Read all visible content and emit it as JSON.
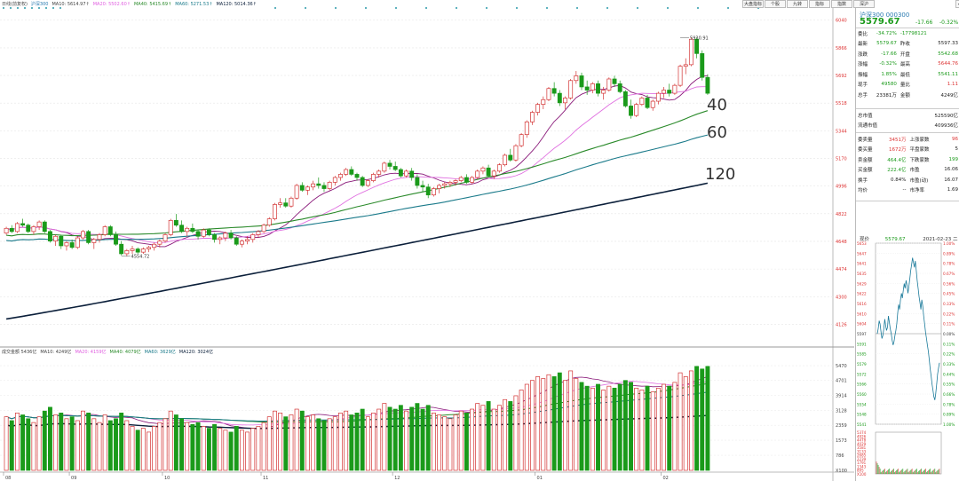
{
  "main_legend": {
    "items": [
      {
        "text": "日线(前复权)",
        "color": "#444444"
      },
      {
        "text": "沪深300",
        "color": "#2a7ab0"
      },
      {
        "text": "MA10: 5614.97↑",
        "color": "#444444"
      },
      {
        "text": "MA20: 5502.60↑",
        "color": "#e060e0"
      },
      {
        "text": "MA40: 5415.69↑",
        "color": "#2a8a2a"
      },
      {
        "text": "MA60: 5271.53↑",
        "color": "#1a7a8a"
      },
      {
        "text": "MA120: 5014.36↑",
        "color": "#0b1f3a"
      }
    ]
  },
  "volume_legend": {
    "items": [
      {
        "text": "成交金额 5436亿",
        "color": "#444444"
      },
      {
        "text": "MA10: 4249亿",
        "color": "#444444"
      },
      {
        "text": "MA20: 4159亿",
        "color": "#e060e0"
      },
      {
        "text": "MA40: 4079亿",
        "color": "#2a8a2a"
      },
      {
        "text": "MA60: 3629亿",
        "color": "#1a7a8a"
      },
      {
        "text": "MA120: 3024亿",
        "color": "#0b1f3a"
      }
    ]
  },
  "toolbar": {
    "buttons": [
      "大盘指标",
      "个股",
      "九转",
      "指标",
      "指数",
      "深沪"
    ]
  },
  "annotations": {
    "high_label": "5930.91",
    "low_label": "4554.72",
    "ma40_label": "40",
    "ma60_label": "60",
    "ma120_label": "120"
  },
  "colors": {
    "up": "#d33333",
    "down": "#1a9a1a",
    "ma10": "#8a1a7a",
    "ma20": "#e070e0",
    "ma40": "#2a8a2a",
    "ma60": "#1a7a8a",
    "ma120": "#0b1f3a"
  },
  "chart_data": {
    "type": "candlestick",
    "price_axis_ticks": [
      "6040",
      "5866",
      "5692",
      "5518",
      "5344",
      "5170",
      "4996",
      "4822",
      "4648",
      "4474",
      "4300",
      "4126"
    ],
    "price_ylim": [
      4000,
      6100
    ],
    "volume_axis_ticks": [
      "5470",
      "4701",
      "3914",
      "3128",
      "2359",
      "1573",
      "786",
      "X100"
    ],
    "volume_ylim": [
      0,
      5800
    ],
    "x_ticks": [
      {
        "label": "08",
        "index": 0
      },
      {
        "label": "09",
        "index": 12
      },
      {
        "label": "10",
        "index": 29
      },
      {
        "label": "11",
        "index": 47
      },
      {
        "label": "12",
        "index": 71
      },
      {
        "label": "01",
        "index": 97
      },
      {
        "label": "02",
        "index": 120
      }
    ],
    "ohlc": [
      [
        4700,
        4740,
        4690,
        4730,
        2800
      ],
      [
        4730,
        4750,
        4700,
        4710,
        2600
      ],
      [
        4710,
        4770,
        4700,
        4760,
        3000
      ],
      [
        4760,
        4790,
        4740,
        4750,
        2900
      ],
      [
        4750,
        4760,
        4700,
        4710,
        2700
      ],
      [
        4710,
        4750,
        4690,
        4740,
        2500
      ],
      [
        4740,
        4780,
        4720,
        4770,
        2800
      ],
      [
        4770,
        4780,
        4700,
        4710,
        3100
      ],
      [
        4710,
        4720,
        4640,
        4650,
        3300
      ],
      [
        4650,
        4690,
        4620,
        4680,
        2900
      ],
      [
        4680,
        4690,
        4600,
        4620,
        3000
      ],
      [
        4620,
        4650,
        4590,
        4640,
        2700
      ],
      [
        4640,
        4660,
        4600,
        4610,
        2800
      ],
      [
        4610,
        4680,
        4600,
        4670,
        2600
      ],
      [
        4670,
        4720,
        4660,
        4710,
        3100
      ],
      [
        4710,
        4720,
        4630,
        4640,
        3000
      ],
      [
        4640,
        4670,
        4600,
        4660,
        2700
      ],
      [
        4660,
        4700,
        4640,
        4690,
        2500
      ],
      [
        4690,
        4750,
        4680,
        4740,
        2900
      ],
      [
        4740,
        4750,
        4680,
        4690,
        2600
      ],
      [
        4690,
        4710,
        4620,
        4630,
        2700
      ],
      [
        4630,
        4650,
        4560,
        4570,
        3000
      ],
      [
        4570,
        4600,
        4555,
        4590,
        2600
      ],
      [
        4590,
        4620,
        4570,
        4600,
        2300
      ],
      [
        4600,
        4610,
        4570,
        4580,
        2100
      ],
      [
        4580,
        4610,
        4570,
        4600,
        2200
      ],
      [
        4600,
        4620,
        4580,
        4610,
        2000
      ],
      [
        4610,
        4640,
        4590,
        4630,
        2300
      ],
      [
        4630,
        4660,
        4610,
        4650,
        2500
      ],
      [
        4650,
        4700,
        4640,
        4690,
        2700
      ],
      [
        4690,
        4790,
        4680,
        4780,
        3100
      ],
      [
        4780,
        4820,
        4740,
        4750,
        2900
      ],
      [
        4750,
        4780,
        4700,
        4710,
        2700
      ],
      [
        4710,
        4740,
        4680,
        4730,
        2500
      ],
      [
        4730,
        4760,
        4700,
        4710,
        2400
      ],
      [
        4710,
        4720,
        4660,
        4680,
        2500
      ],
      [
        4680,
        4730,
        4670,
        4720,
        2300
      ],
      [
        4720,
        4730,
        4680,
        4690,
        2200
      ],
      [
        4690,
        4700,
        4640,
        4660,
        2400
      ],
      [
        4660,
        4680,
        4630,
        4670,
        2200
      ],
      [
        4670,
        4710,
        4650,
        4700,
        2100
      ],
      [
        4700,
        4720,
        4660,
        4670,
        2000
      ],
      [
        4670,
        4680,
        4620,
        4630,
        2300
      ],
      [
        4630,
        4660,
        4610,
        4650,
        2100
      ],
      [
        4650,
        4680,
        4630,
        4660,
        2000
      ],
      [
        4660,
        4700,
        4640,
        4690,
        2200
      ],
      [
        4690,
        4720,
        4670,
        4710,
        2300
      ],
      [
        4710,
        4760,
        4700,
        4750,
        2500
      ],
      [
        4750,
        4800,
        4740,
        4790,
        2800
      ],
      [
        4790,
        4890,
        4780,
        4880,
        3100
      ],
      [
        4880,
        4920,
        4860,
        4890,
        3000
      ],
      [
        4890,
        4920,
        4860,
        4870,
        2800
      ],
      [
        4870,
        4930,
        4860,
        4920,
        2900
      ],
      [
        4920,
        5010,
        4910,
        5000,
        3200
      ],
      [
        5000,
        5020,
        4960,
        4970,
        3100
      ],
      [
        4970,
        5000,
        4940,
        4990,
        2800
      ],
      [
        4990,
        5030,
        4970,
        5010,
        2900
      ],
      [
        5010,
        5050,
        4980,
        5000,
        2700
      ],
      [
        5000,
        5020,
        4960,
        4980,
        2600
      ],
      [
        4980,
        5030,
        4970,
        5020,
        2700
      ],
      [
        5020,
        5060,
        5000,
        5050,
        2800
      ],
      [
        5050,
        5080,
        5030,
        5070,
        3000
      ],
      [
        5070,
        5110,
        5060,
        5100,
        3100
      ],
      [
        5100,
        5120,
        5060,
        5070,
        2900
      ],
      [
        5070,
        5080,
        5030,
        5050,
        3000
      ],
      [
        5050,
        5060,
        4990,
        5000,
        3200
      ],
      [
        5000,
        5040,
        4990,
        5030,
        2800
      ],
      [
        5030,
        5080,
        5020,
        5070,
        3000
      ],
      [
        5070,
        5100,
        5050,
        5090,
        3200
      ],
      [
        5090,
        5150,
        5080,
        5140,
        3500
      ],
      [
        5140,
        5160,
        5100,
        5120,
        3300
      ],
      [
        5120,
        5150,
        5090,
        5100,
        3200
      ],
      [
        5100,
        5110,
        5050,
        5060,
        3400
      ],
      [
        5060,
        5100,
        5050,
        5090,
        3100
      ],
      [
        5090,
        5110,
        5030,
        5050,
        3300
      ],
      [
        5050,
        5070,
        4980,
        5000,
        3500
      ],
      [
        5000,
        5030,
        4960,
        4990,
        3200
      ],
      [
        4990,
        5010,
        4920,
        4940,
        3400
      ],
      [
        4940,
        4990,
        4930,
        4980,
        3000
      ],
      [
        4980,
        5010,
        4950,
        5000,
        2900
      ],
      [
        5000,
        5020,
        4980,
        5010,
        2800
      ],
      [
        5010,
        5030,
        4990,
        5020,
        2700
      ],
      [
        5020,
        5040,
        5000,
        5030,
        2900
      ],
      [
        5030,
        5060,
        5020,
        5050,
        3100
      ],
      [
        5050,
        5070,
        5010,
        5020,
        3000
      ],
      [
        5020,
        5060,
        5010,
        5050,
        3200
      ],
      [
        5050,
        5100,
        5040,
        5090,
        3500
      ],
      [
        5090,
        5120,
        5070,
        5110,
        3400
      ],
      [
        5110,
        5130,
        5050,
        5060,
        3600
      ],
      [
        5060,
        5100,
        5040,
        5090,
        3200
      ],
      [
        5090,
        5140,
        5080,
        5130,
        3400
      ],
      [
        5130,
        5200,
        5120,
        5190,
        3700
      ],
      [
        5190,
        5230,
        5150,
        5160,
        3600
      ],
      [
        5160,
        5260,
        5150,
        5250,
        3900
      ],
      [
        5250,
        5330,
        5240,
        5320,
        4200
      ],
      [
        5320,
        5410,
        5300,
        5400,
        4500
      ],
      [
        5400,
        5470,
        5380,
        5460,
        4700
      ],
      [
        5460,
        5520,
        5440,
        5510,
        4900
      ],
      [
        5510,
        5560,
        5480,
        5540,
        4800
      ],
      [
        5540,
        5620,
        5530,
        5610,
        5000
      ],
      [
        5610,
        5650,
        5560,
        5580,
        4900
      ],
      [
        5580,
        5600,
        5500,
        5520,
        5100
      ],
      [
        5520,
        5560,
        5480,
        5550,
        4700
      ],
      [
        5550,
        5670,
        5540,
        5660,
        5200
      ],
      [
        5660,
        5720,
        5640,
        5690,
        4800
      ],
      [
        5690,
        5710,
        5600,
        5620,
        4600
      ],
      [
        5620,
        5660,
        5570,
        5600,
        4400
      ],
      [
        5600,
        5650,
        5580,
        5640,
        4300
      ],
      [
        5640,
        5660,
        5560,
        5580,
        4500
      ],
      [
        5580,
        5620,
        5540,
        5600,
        4200
      ],
      [
        5600,
        5680,
        5590,
        5670,
        4400
      ],
      [
        5670,
        5690,
        5620,
        5640,
        4300
      ],
      [
        5640,
        5660,
        5580,
        5590,
        4500
      ],
      [
        5590,
        5600,
        5490,
        5500,
        4700
      ],
      [
        5500,
        5540,
        5420,
        5440,
        4600
      ],
      [
        5440,
        5520,
        5430,
        5510,
        4300
      ],
      [
        5510,
        5560,
        5500,
        5550,
        4200
      ],
      [
        5550,
        5570,
        5480,
        5490,
        4400
      ],
      [
        5490,
        5540,
        5470,
        5530,
        4100
      ],
      [
        5530,
        5590,
        5510,
        5580,
        4300
      ],
      [
        5580,
        5620,
        5550,
        5600,
        4500
      ],
      [
        5600,
        5640,
        5560,
        5580,
        4400
      ],
      [
        5580,
        5640,
        5570,
        5630,
        4600
      ],
      [
        5630,
        5760,
        5620,
        5750,
        5100
      ],
      [
        5750,
        5800,
        5700,
        5760,
        4900
      ],
      [
        5760,
        5931,
        5750,
        5920,
        5200
      ],
      [
        5920,
        5930,
        5800,
        5830,
        5436
      ],
      [
        5830,
        5850,
        5660,
        5680,
        5300
      ],
      [
        5680,
        5700,
        5570,
        5580,
        5436
      ]
    ],
    "ma_series": [
      {
        "name": "MA10",
        "period": 10
      },
      {
        "name": "MA20",
        "period": 20
      },
      {
        "name": "MA40",
        "period": 40
      },
      {
        "name": "MA60",
        "period": 60
      },
      {
        "name": "MA120",
        "period": 120
      }
    ]
  },
  "quote": {
    "title": "沪深300 000300",
    "price": "5579.67",
    "change": "-17.66",
    "change_pct": "-0.32%",
    "rows": [
      [
        {
          "t": "委比",
          "c": "k"
        },
        {
          "t": "-34.72%",
          "c": "g"
        },
        {
          "t": "-17798121",
          "c": "g"
        },
        {
          "t": "",
          "c": "k"
        }
      ],
      [
        {
          "t": "最新",
          "c": "k"
        },
        {
          "t": "5579.67",
          "c": "g"
        },
        {
          "t": "昨收",
          "c": "k"
        },
        {
          "t": "5597.33",
          "c": "k"
        }
      ],
      [
        {
          "t": "涨跌",
          "c": "k"
        },
        {
          "t": "-17.66",
          "c": "g"
        },
        {
          "t": "开盘",
          "c": "k"
        },
        {
          "t": "5542.68",
          "c": "g"
        }
      ],
      [
        {
          "t": "涨幅",
          "c": "k"
        },
        {
          "t": "-0.32%",
          "c": "g"
        },
        {
          "t": "最高",
          "c": "k"
        },
        {
          "t": "5644.76",
          "c": "r"
        }
      ],
      [
        {
          "t": "振幅",
          "c": "k"
        },
        {
          "t": "1.85%",
          "c": "g"
        },
        {
          "t": "最低",
          "c": "k"
        },
        {
          "t": "5541.11",
          "c": "g"
        }
      ],
      [
        {
          "t": "现手",
          "c": "k"
        },
        {
          "t": "49580",
          "c": "g"
        },
        {
          "t": "量比",
          "c": "k"
        },
        {
          "t": "1.11",
          "c": "r"
        }
      ],
      [
        {
          "t": "总手",
          "c": "k"
        },
        {
          "t": "23381万",
          "c": "k"
        },
        {
          "t": "金额",
          "c": "k"
        },
        {
          "t": "4249亿",
          "c": "k"
        }
      ]
    ],
    "rows2": [
      [
        {
          "t": "总市值",
          "c": "k"
        },
        {
          "t": "",
          "c": "k"
        },
        {
          "t": "",
          "c": "k"
        },
        {
          "t": "525590亿",
          "c": "k"
        }
      ],
      [
        {
          "t": "流通市值",
          "c": "k"
        },
        {
          "t": "",
          "c": "k"
        },
        {
          "t": "",
          "c": "k"
        },
        {
          "t": "409936亿",
          "c": "k"
        }
      ]
    ],
    "rows3": [
      [
        {
          "t": "委卖量",
          "c": "k"
        },
        {
          "t": "3451万",
          "c": "r"
        },
        {
          "t": "上涨家数",
          "c": "k"
        },
        {
          "t": "96",
          "c": "r"
        }
      ],
      [
        {
          "t": "委买量",
          "c": "k"
        },
        {
          "t": "1672万",
          "c": "r"
        },
        {
          "t": "平盘家数",
          "c": "k"
        },
        {
          "t": "5",
          "c": "k"
        }
      ],
      [
        {
          "t": "卖金额",
          "c": "k"
        },
        {
          "t": "464.4亿",
          "c": "g"
        },
        {
          "t": "下跌家数",
          "c": "k"
        },
        {
          "t": "199",
          "c": "g"
        }
      ],
      [
        {
          "t": "买金额",
          "c": "k"
        },
        {
          "t": "222.4亿",
          "c": "g"
        },
        {
          "t": "市盈",
          "c": "k"
        },
        {
          "t": "16.06",
          "c": "k"
        }
      ],
      [
        {
          "t": "换手",
          "c": "k"
        },
        {
          "t": "0.84%",
          "c": "k"
        },
        {
          "t": "市盈(动)",
          "c": "k"
        },
        {
          "t": "16.07",
          "c": "k"
        }
      ],
      [
        {
          "t": "均价",
          "c": "k"
        },
        {
          "t": "--",
          "c": "k"
        },
        {
          "t": "市净率",
          "c": "k"
        },
        {
          "t": "1.69",
          "c": "k"
        }
      ]
    ]
  },
  "intraday": {
    "label": "现价",
    "price": "5579.67",
    "date": "2021-02-23 二",
    "left_ticks": [
      "5653",
      "5647",
      "5641",
      "5635",
      "5629",
      "5622",
      "5616",
      "5610",
      "5604",
      "5597",
      "5591",
      "5585",
      "5579",
      "5572",
      "5566",
      "5560",
      "5554",
      "5548",
      "5541"
    ],
    "right_ticks": [
      "1.00%",
      "0.89%",
      "0.78%",
      "0.67%",
      "0.56%",
      "0.45%",
      "0.33%",
      "0.22%",
      "0.11%",
      "0.00%",
      "0.11%",
      "0.22%",
      "0.33%",
      "0.44%",
      "0.55%",
      "0.66%",
      "0.78%",
      "0.89%",
      "1.00%"
    ],
    "vol_ticks": [
      "5374",
      "4926",
      "4478",
      "4029",
      "3581",
      "3133",
      "2685",
      "2239",
      "1791",
      "1343",
      "895",
      "X100"
    ],
    "prices": [
      5597,
      5600,
      5605,
      5603,
      5598,
      5594,
      5596,
      5600,
      5606,
      5602,
      5599,
      5601,
      5608,
      5604,
      5600,
      5597,
      5593,
      5590,
      5592,
      5596,
      5599,
      5603,
      5610,
      5615,
      5612,
      5618,
      5622,
      5619,
      5624,
      5628,
      5625,
      5630,
      5627,
      5622,
      5626,
      5631,
      5636,
      5640,
      5644,
      5641,
      5638,
      5642,
      5636,
      5630,
      5625,
      5620,
      5616,
      5612,
      5618,
      5614,
      5608,
      5603,
      5598,
      5594,
      5590,
      5586,
      5581,
      5575,
      5571,
      5566,
      5562,
      5558,
      5556,
      5560,
      5566,
      5572,
      5576,
      5579
    ]
  }
}
